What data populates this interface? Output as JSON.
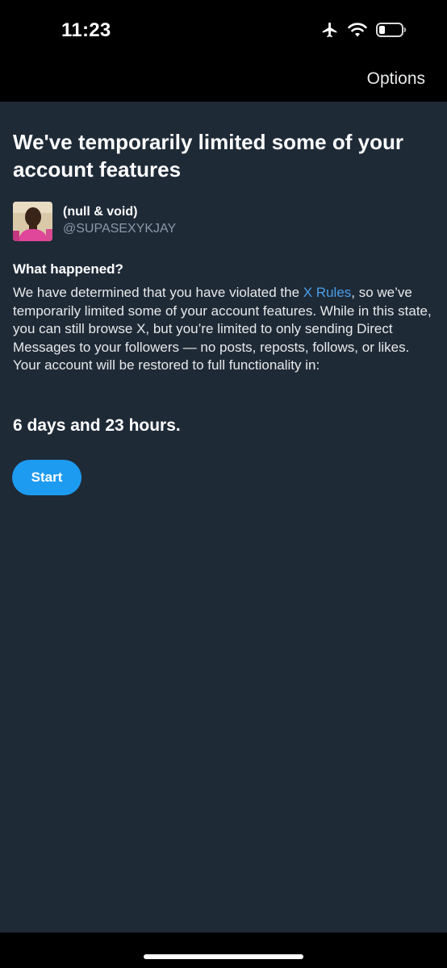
{
  "status_bar": {
    "time": "11:23"
  },
  "nav": {
    "options_label": "Options"
  },
  "notice": {
    "title": "We've temporarily limited some of your account features",
    "account": {
      "display_name": "(null & void)",
      "handle": "@SUPASEXYKJAY"
    },
    "section_heading": "What happened?",
    "body_before_link": "We have determined that you have violated the ",
    "rules_link_text": "X Rules",
    "body_after_link": ", so we’ve temporarily limited some of your account features. While in this state, you can still browse X, but you’re limited to only sending Direct Messages to your followers — no posts, reposts, follows, or likes. Your account will be restored to full functionality in:",
    "duration": "6 days and 23 hours.",
    "start_label": "Start"
  },
  "colors": {
    "background": "#1f2a37",
    "accent": "#1d9bf0",
    "link": "#4a9ee8",
    "secondary_text": "#8b98a5"
  },
  "icons": [
    "airplane-icon",
    "wifi-icon",
    "battery-icon"
  ]
}
